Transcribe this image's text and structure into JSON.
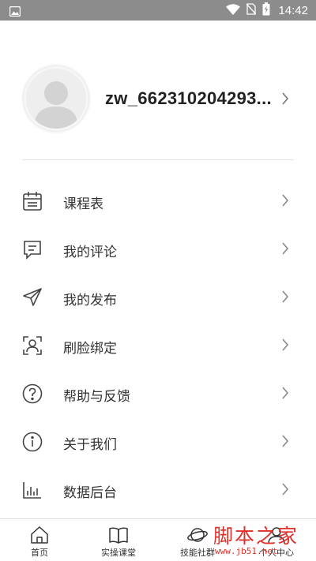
{
  "status_bar": {
    "time": "14:42"
  },
  "profile": {
    "username": "zw_662310204293..."
  },
  "menu": [
    {
      "label": "课程表",
      "icon": "calendar-icon"
    },
    {
      "label": "我的评论",
      "icon": "comment-icon"
    },
    {
      "label": "我的发布",
      "icon": "send-icon"
    },
    {
      "label": "刷脸绑定",
      "icon": "face-scan-icon"
    },
    {
      "label": "帮助与反馈",
      "icon": "help-icon"
    },
    {
      "label": "关于我们",
      "icon": "info-icon"
    },
    {
      "label": "数据后台",
      "icon": "bar-chart-icon"
    }
  ],
  "bottom_nav": [
    {
      "label": "首页",
      "icon": "home-icon"
    },
    {
      "label": "实操课堂",
      "icon": "book-icon"
    },
    {
      "label": "技能社群",
      "icon": "planet-icon"
    },
    {
      "label": "个人中心",
      "icon": "person-icon"
    }
  ],
  "watermark": {
    "title": "脚本之家",
    "url": "www.jb51.net"
  },
  "colors": {
    "status_bar": "#8c8c8c",
    "watermark": "#e0302a",
    "text": "#333333"
  }
}
